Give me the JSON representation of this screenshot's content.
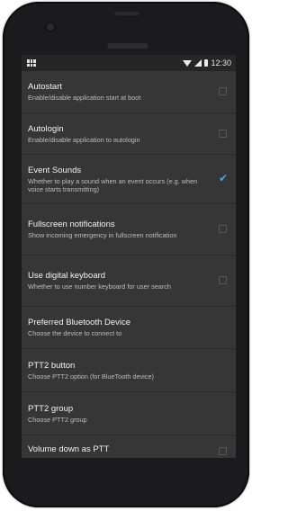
{
  "status_bar": {
    "time": "12:30"
  },
  "settings": [
    {
      "title": "Autostart",
      "subtitle": "Enable/disable application start at boot",
      "control": "checkbox",
      "checked": false
    },
    {
      "title": "Autologin",
      "subtitle": "Enable/disable application to autologin",
      "control": "checkbox",
      "checked": false
    },
    {
      "title": "Event Sounds",
      "subtitle": "Whether to play a sound when an event occurs (e.g. when voice starts transmitting)",
      "control": "checkbox",
      "checked": true
    },
    {
      "title": "Fullscreen notifications",
      "subtitle": "Show incoming emergency in fullscreen notification",
      "control": "checkbox",
      "checked": false
    },
    {
      "title": "Use digital keyboard",
      "subtitle": "Whether to use number keyboard for user search",
      "control": "checkbox",
      "checked": false
    },
    {
      "title": "Preferred Bluetooth Device",
      "subtitle": "Choose the device to connect to",
      "control": "none"
    },
    {
      "title": "PTT2 button",
      "subtitle": "Choose PTT2 option (for BlueTooth device)",
      "control": "none"
    },
    {
      "title": "PTT2 group",
      "subtitle": "Choose PTT2 group",
      "control": "none"
    },
    {
      "title": "Volume down as PTT",
      "subtitle": "",
      "control": "checkbox",
      "checked": false
    }
  ],
  "colors": {
    "accent": "#4aa3df",
    "background": "#363636",
    "statusbar": "#262626"
  }
}
